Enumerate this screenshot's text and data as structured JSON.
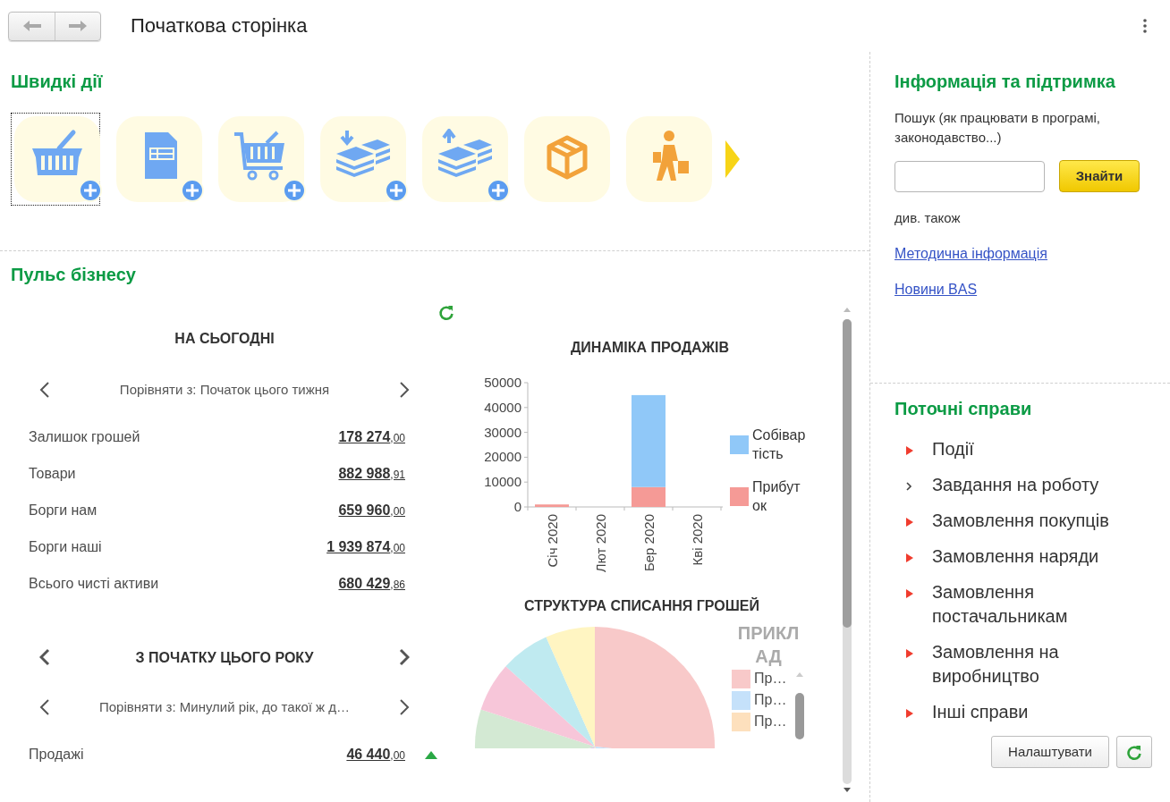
{
  "header": {
    "title": "Початкова сторінка"
  },
  "quick_actions": {
    "title": "Швидкі дії",
    "items": [
      {
        "kind": "basket",
        "add": true,
        "selected": true
      },
      {
        "kind": "document",
        "add": true,
        "selected": false
      },
      {
        "kind": "cart",
        "add": true,
        "selected": false
      },
      {
        "kind": "income",
        "add": true,
        "selected": false
      },
      {
        "kind": "expense",
        "add": true,
        "selected": false
      },
      {
        "kind": "package",
        "add": false,
        "selected": false
      },
      {
        "kind": "traveler",
        "add": false,
        "selected": false
      }
    ]
  },
  "business_pulse": {
    "title": "Пульс бізнесу",
    "today": {
      "title": "НА СЬОГОДНІ",
      "compare": "Порівняти з: Початок цього тижня",
      "rows": [
        {
          "label": "Залишок грошей",
          "amount": "178 274",
          "cents": ",00"
        },
        {
          "label": "Товари",
          "amount": "882 988",
          "cents": ",91"
        },
        {
          "label": "Борги нам",
          "amount": "659 960",
          "cents": ",00"
        },
        {
          "label": "Борги наші",
          "amount": "1 939 874",
          "cents": ",00"
        },
        {
          "label": "Всього чисті активи",
          "amount": "680 429",
          "cents": ",86"
        }
      ]
    },
    "year": {
      "title": "З ПОЧАТКУ ЦЬОГО РОКУ",
      "compare": "Порівняти з: Минулий рік, до такої ж д…",
      "rows": [
        {
          "label": "Продажі",
          "amount": "46 440",
          "cents": ",00",
          "rising": true
        }
      ]
    },
    "sales_chart": {
      "chart_data": {
        "type": "bar",
        "title": "ДИНАМІКА ПРОДАЖІВ",
        "categories": [
          "Січ 2020",
          "Лют 2020",
          "Бер 2020",
          "Кві 2020"
        ],
        "series": [
          {
            "name": "Собівартість",
            "color": "#90c8f8",
            "values": [
              0,
              0,
              37000,
              0
            ]
          },
          {
            "name": "Прибуток",
            "color": "#f59a96",
            "values": [
              1000,
              0,
              8000,
              0
            ]
          }
        ],
        "ylim": [
          0,
          50000
        ],
        "yticks": [
          0,
          10000,
          20000,
          30000,
          40000,
          50000
        ],
        "stacked": true,
        "legend": "right"
      }
    },
    "expense_chart": {
      "title": "СТРУКТУРА СПИСАННЯ ГРОШЕЙ",
      "legend_title": "ПРИКЛАД",
      "legend": [
        {
          "label": "Пр…",
          "color": "#f8c9c9"
        },
        {
          "label": "Пр…",
          "color": "#c5e1fa"
        },
        {
          "label": "Пр…",
          "color": "#fde0bd"
        }
      ]
    }
  },
  "info": {
    "title": "Інформація та підтримка",
    "search_label": "Пошук (як працювати в програмі, законодавство...)",
    "search_button": "Знайти",
    "see_also": "див. також",
    "links": [
      "Методична інформація",
      "Новини BAS"
    ]
  },
  "current_tasks": {
    "title": "Поточні справи",
    "items": [
      {
        "label": "Події",
        "highlighted": true
      },
      {
        "label": "Завдання на роботу",
        "highlighted": false
      },
      {
        "label": "Замовлення покупців",
        "highlighted": true
      },
      {
        "label": "Замовлення наряди",
        "highlighted": true
      },
      {
        "label": "Замовлення постачальникам",
        "highlighted": true
      },
      {
        "label": "Замовлення на виробництво",
        "highlighted": true
      },
      {
        "label": "Інші справи",
        "highlighted": true
      }
    ],
    "settings_button": "Налаштувати"
  }
}
